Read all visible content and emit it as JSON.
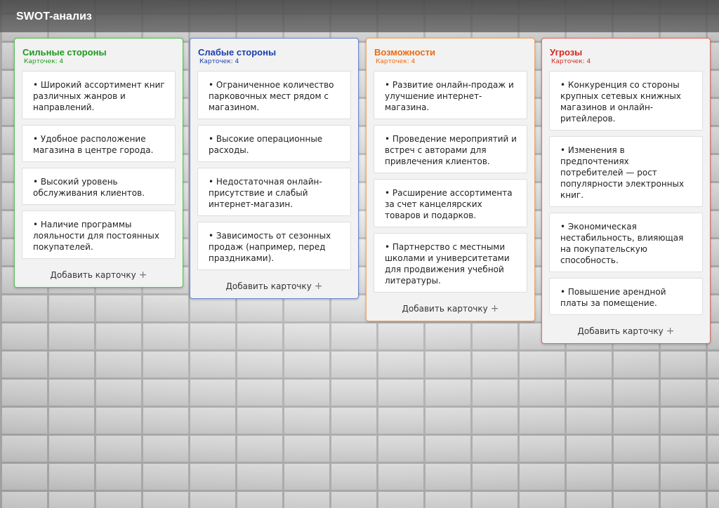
{
  "app": {
    "title": "SWOT-анализ"
  },
  "add_card_label": "Добавить карточку",
  "columns": [
    {
      "title": "Сильные стороны",
      "count_label": "Карточек: 4",
      "color": "#1c9a1c",
      "border": "#5cbf5c",
      "cards": [
        "• Широкий ассортимент книг различных жанров и направлений.",
        "• Удобное расположение магазина в центре города.",
        "• Высокий уровень обслуживания клиентов.",
        "• Наличие программы лояльности для постоянных покупателей."
      ]
    },
    {
      "title": "Слабые стороны",
      "count_label": "Карточек: 4",
      "color": "#1a3fae",
      "border": "#6a87d4",
      "cards": [
        "• Ограниченное количество парковочных мест рядом с магазином.",
        "• Высокие операционные расходы.",
        "• Недостаточная онлайн-присутствие и слабый интернет-магазин.",
        "• Зависимость от сезонных продаж (например, перед праздниками)."
      ]
    },
    {
      "title": "Возможности",
      "count_label": "Карточек: 4",
      "color": "#ee6a0c",
      "border": "#f0a86a",
      "cards": [
        "• Развитие онлайн-продаж и улучшение интернет-магазина.",
        "• Проведение мероприятий и встреч с авторами для привлечения клиентов.",
        "• Расширение ассортимента за счет канцелярских товаров и подарков.",
        "• Партнерство с местными школами и университетами для продвижения учебной литературы."
      ]
    },
    {
      "title": "Угрозы",
      "count_label": "Карточек: 4",
      "color": "#d8261b",
      "border": "#e46a62",
      "cards": [
        "• Конкуренция со стороны крупных сетевых книжных магазинов и онлайн-ритейлеров.",
        "• Изменения в предпочтениях потребителей — рост популярности электронных книг.",
        "• Экономическая нестабильность, влияющая на покупательскую способность.",
        "• Повышение арендной платы за помещение."
      ]
    }
  ]
}
